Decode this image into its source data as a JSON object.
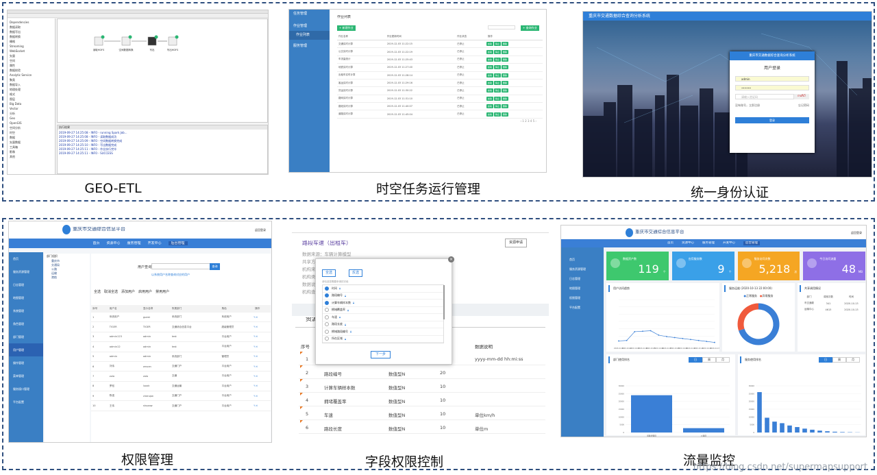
{
  "captions": [
    "GEO-ETL",
    "时空任务运行管理",
    "统一身份认证",
    "权限管理",
    "字段权限控制",
    "流量监控"
  ],
  "watermark": "https://blog.csdn.net/supermapsupport",
  "etl": {
    "tree_items": [
      "Dependencies",
      "数据读取",
      "数据写出",
      "数据转换",
      "栅格",
      "Streaming",
      "WebSocket",
      "矢量",
      "空间",
      "属性",
      "数据校验",
      "Analytic Service",
      "聚类",
      "数据导入",
      "地理处理",
      "格式",
      "图层",
      "Big Data",
      "Vector",
      "分析",
      "Geo",
      "OpenGIS",
      "空间分析",
      "时空",
      "数据",
      "矢量数据",
      "工具箱",
      "影像",
      "其他"
    ],
    "nodes": [
      "读取HDFS",
      "空间数据转换",
      "写出",
      "写出HDFS"
    ],
    "log_title": "执行结果",
    "log_lines": [
      "2019-09-27 14:25:08 - INFO - running Spark Job...",
      "2019-09-27 14:25:08 - INFO - 读取数据成功",
      "2019-09-27 14:25:09 - INFO - 空间数据转换完成",
      "2019-09-27 14:25:10 - INFO - 写出数据完成",
      "2019-09-27 14:25:11 - INFO - 作业执行完毕",
      "2019-09-27 14:25:11 - INFO - SUCCESS"
    ]
  },
  "task": {
    "menu": [
      "任务管理",
      "作业管理",
      "作业列表",
      "服务管理"
    ],
    "title": "作业列表",
    "add_btn": "+ 新建作业",
    "search_btn": "+ 查询作业",
    "columns": [
      "作业名称",
      "作业更新时间",
      "作业状态",
      "操作"
    ],
    "rows": [
      [
        "交通实时计算",
        "2019-12-03 11:22:15",
        "已停止"
      ],
      [
        "公交实时计算",
        "2019-12-03 11:22:19",
        "已停止"
      ],
      [
        "车流量统计",
        "2019-12-03 11:25:43",
        "已停止"
      ],
      [
        "地铁实时计算",
        "2019-12-03 11:27:40",
        "已停止"
      ],
      [
        "出租车实时计算",
        "2019-12-03 11:28:14",
        "已停止"
      ],
      [
        "客运实时计算",
        "2019-12-03 11:29:16",
        "已停止"
      ],
      [
        "货运实时计算",
        "2019-12-03 11:30:22",
        "已停止"
      ],
      [
        "路网实时计算",
        "2019-12-03 11:31:10",
        "已停止"
      ],
      [
        "路段实时计算",
        "2019-12-03 11:40:07",
        "已停止"
      ],
      [
        "道路实时计算",
        "2019-12-03 11:45:04",
        "已停止"
      ]
    ],
    "ops": [
      "启动",
      "停止",
      "删除"
    ]
  },
  "auth": {
    "banner": "重庆市交通数据综合查询分析系统",
    "box_title": "重庆市交通数据综合查询分析系统",
    "login_title": "用户登录",
    "user_value": "admin",
    "pass_value": "••••••",
    "captcha_placeholder": "请输入验证码",
    "captcha_img": "mdN5",
    "register": "没有账号，立即注册",
    "forgot": "忘记密码",
    "login_btn": "登录"
  },
  "perm": {
    "logo_title": "重庆市交通综合信息平台",
    "logout": "返回登录",
    "nav": [
      "首页",
      "资源中心",
      "服务管理",
      "开发中心",
      "后台管理"
    ],
    "side": [
      "首页",
      "服务资源管理",
      "日志管理",
      "地图管理",
      "系统管理",
      "角色管理",
      "部门管理",
      "用户管理",
      "操作管理",
      "菜单管理",
      "服务接口管理",
      "平台配置"
    ],
    "tree_root": "部门组织",
    "tree_items": [
      "重庆市",
      "交通局",
      "公路",
      "运输",
      "港航"
    ],
    "search_label": "用户查询",
    "search_btn": "查询",
    "hint": "以系统用户名称查询对应的用户",
    "actions": [
      "全选",
      "取消全选",
      "添加用户",
      "启用用户",
      "禁用用户"
    ],
    "columns": [
      "序号",
      "用户名",
      "显示名称",
      "所属部门",
      "角色",
      "操作"
    ],
    "rows": [
      [
        "1",
        "系统用户",
        "guest",
        "系统部门",
        "系统用户"
      ],
      [
        "2",
        "TIGER",
        "TIGER",
        "交通综合信息平台",
        "超级管理员"
      ],
      [
        "3",
        "admin123",
        "admin",
        "test",
        "平台用户"
      ],
      [
        "4",
        "admin12",
        "admin",
        "test",
        "平台用户"
      ],
      [
        "5",
        "admin",
        "admin",
        "系统部门",
        "管理员"
      ],
      [
        "6",
        "刘伟",
        "wnuan",
        "交通门户",
        "平台用户"
      ],
      [
        "7",
        "zolo",
        "zolo",
        "交通",
        "平台用户"
      ],
      [
        "8",
        "罗松",
        "luoxk",
        "交通运输",
        "平台用户"
      ],
      [
        "9",
        "陈强",
        "chenqiw",
        "交通门户",
        "平台用户"
      ],
      [
        "10",
        "王伟",
        "shuaaw",
        "交通门户",
        "平台用户"
      ]
    ]
  },
  "field": {
    "title": "路段车速（出租车）",
    "apply_btn": "资源申请",
    "meta": [
      "数据来源：车辆计算模型",
      "共享方式：",
      "机构来源：",
      "机构类别：",
      "数据说明：",
      "机构查看："
    ],
    "tab": "资源",
    "col_serial": "序号",
    "col_desc": "数据说明",
    "rows": [
      [
        "1",
        "",
        "",
        "",
        "yyyy-mm-dd hh:mi:ss"
      ],
      [
        "2",
        "路段编号",
        "数值型N",
        "20",
        ""
      ],
      [
        "3",
        "计算车辆样本数",
        "数值型N",
        "10",
        ""
      ],
      [
        "4",
        "拥堵覆盖率",
        "数值型N",
        "10",
        ""
      ],
      [
        "5",
        "车速",
        "数值型N",
        "10",
        "单位km/h"
      ],
      [
        "6",
        "路段长度",
        "数值型N",
        "10",
        "单位m"
      ]
    ],
    "dlg_all": "全选",
    "dlg_none": "反选",
    "dlg_hint": "请勾选您需要申请的字段",
    "dlg_fields": [
      "时间",
      "路段编号",
      "计算车辆样本数",
      "拥堵覆盖率",
      "车速",
      "路段长度",
      "拥堵路段编号",
      "所在区域"
    ],
    "dlg_checked": [
      true,
      true,
      true,
      false,
      false,
      false,
      false,
      false
    ],
    "dlg_next": "下一步"
  },
  "flow": {
    "logo_title": "重庆市交通综合信息平台",
    "logout": "返回登录",
    "nav": [
      "首页",
      "资源中心",
      "服务管理",
      "开发中心",
      "后台管理"
    ],
    "side": [
      "首页",
      "服务资源管理",
      "日志管理",
      "地图管理",
      "权限管理",
      "平台配置"
    ],
    "cards": [
      {
        "label": "数据资产数",
        "value": "119",
        "unit": "个",
        "color": "#3ec86e"
      },
      {
        "label": "应用服务数",
        "value": "9",
        "unit": "个",
        "color": "#3aa0e8"
      },
      {
        "label": "服务访问次数",
        "value": "5,218",
        "unit": "次",
        "color": "#f5a623"
      },
      {
        "label": "今日访问流量",
        "value": "48",
        "unit": "MB",
        "color": "#8e6fe6"
      }
    ],
    "line_title": "用户访问趋势",
    "line_chart": {
      "x": [
        "2020-10-01",
        "2020-10-02",
        "2020-10-03",
        "2020-10-04",
        "2020-10-05",
        "2020-10-06",
        "2020-10-07",
        "2020-10-08",
        "2020-10-09",
        "2020-10-10",
        "2020-10-11",
        "2020-10-12",
        "2020-10-13"
      ],
      "values": [
        5,
        6,
        24,
        25,
        26,
        17,
        14,
        12,
        10,
        8,
        6,
        4,
        2
      ],
      "ylim": [
        0,
        90
      ]
    },
    "donut_title": "服务运维",
    "donut_date": "(2020-10-13 22:00:00)",
    "donut_legend": [
      "正常服务",
      "异常服务"
    ],
    "donut_chart": {
      "values": [
        70,
        30
      ],
      "colors": [
        "#3a7fd6",
        "#f05a3c"
      ]
    },
    "share_title": "共享调用情况",
    "share_cols": [
      "部门",
      "调用次数",
      "时间"
    ],
    "share_rows": [
      [
        "市交通委",
        "341",
        "2020-10-13"
      ],
      [
        "运输中心",
        "4613",
        "2020-10-13"
      ]
    ],
    "dept_title": "部门使用排名",
    "svc_title": "服务使用排名",
    "tabs": [
      "日",
      "周",
      "月"
    ],
    "dept_chart": {
      "categories": [
        "道路管理局",
        "公路局"
      ],
      "values": [
        24000,
        2800
      ],
      "ylim": [
        0,
        30000
      ]
    },
    "svc_chart": {
      "values": [
        26000,
        9500,
        7000,
        6000,
        4500,
        3500,
        2500,
        1800,
        1200,
        800,
        500,
        300,
        200,
        100
      ],
      "ylim": [
        0,
        30000
      ]
    }
  }
}
